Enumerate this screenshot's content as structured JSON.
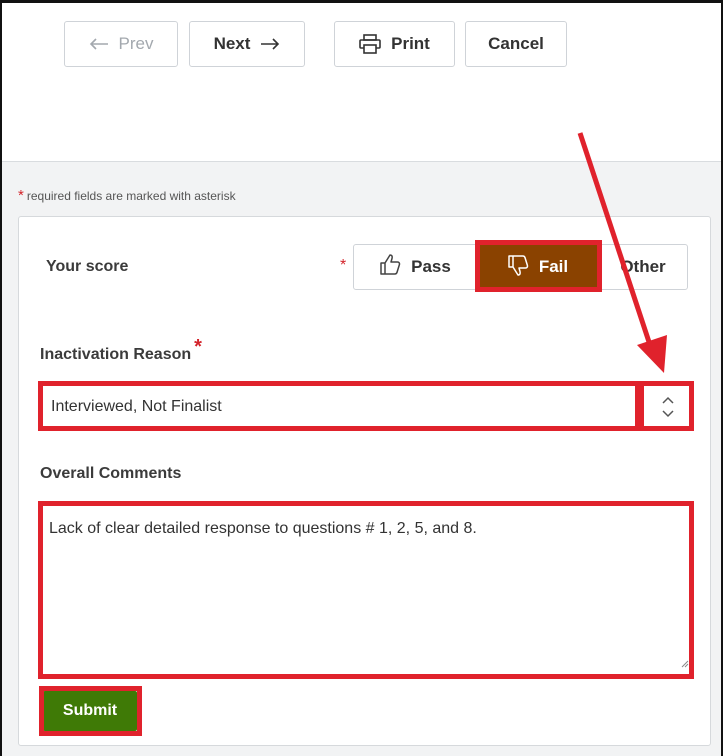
{
  "toolbar": {
    "prev_label": "Prev",
    "next_label": "Next",
    "print_label": "Print",
    "cancel_label": "Cancel"
  },
  "required_note": {
    "asterisk": "*",
    "text": "required fields are marked with asterisk"
  },
  "score": {
    "label": "Your score",
    "required_mark": "*",
    "options": [
      {
        "label": "Pass",
        "icon": "thumbs-up-icon",
        "selected": false
      },
      {
        "label": "Fail",
        "icon": "thumbs-down-icon",
        "selected": true
      },
      {
        "label": "Other",
        "selected": false
      }
    ]
  },
  "inactivation": {
    "label": "Inactivation Reason",
    "required_mark": "*",
    "value": "Interviewed, Not Finalist"
  },
  "comments": {
    "label": "Overall Comments",
    "value": "Lack of clear detailed response to questions # 1, 2, 5, and 8."
  },
  "submit_label": "Submit",
  "colors": {
    "fail_selected": "#8a4200",
    "submit": "#3f7a06",
    "required": "#d3232a",
    "annotation": "#e0222c"
  }
}
